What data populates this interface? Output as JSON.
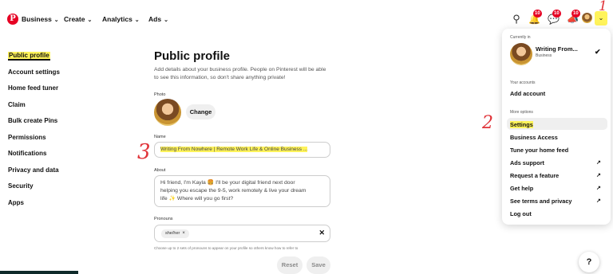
{
  "nav": {
    "logo_glyph": "P",
    "items": [
      "Business",
      "Create",
      "Analytics",
      "Ads"
    ],
    "chevron": "⌄",
    "badges": [
      "10",
      "10",
      "10"
    ]
  },
  "annotations": [
    "1",
    "2",
    "3"
  ],
  "sidebar": {
    "items": [
      {
        "label": "Public profile",
        "active": true
      },
      {
        "label": "Account settings"
      },
      {
        "label": "Home feed tuner"
      },
      {
        "label": "Claim"
      },
      {
        "label": "Bulk create Pins"
      },
      {
        "label": "Permissions"
      },
      {
        "label": "Notifications"
      },
      {
        "label": "Privacy and data"
      },
      {
        "label": "Security"
      },
      {
        "label": "Apps"
      }
    ]
  },
  "main": {
    "title": "Public profile",
    "description": "Add details about your business profile. People on Pinterest will be able to see this information, so don't share anything private!",
    "photo_label": "Photo",
    "change_label": "Change",
    "name_label": "Name",
    "name_value": "Writing From Nowhere | Remote Work Life & Online Business ...",
    "about_label": "About",
    "about_value": "Hi friend, I'm Kayla 🍔 I'll be your digital friend next door\nhelping you escape the 9-5, work remotely & live your dream\nlife ✨ Where will you go first?",
    "pronouns_label": "Pronouns",
    "pronoun_chip": "she/her",
    "pronouns_help": "Choose up to 2 sets of pronouns to appear on your profile so others know how to refer to",
    "reset_label": "Reset",
    "save_label": "Save"
  },
  "dropdown": {
    "currently_in": "Currently in",
    "account_name": "Writing From...",
    "account_type": "Business",
    "your_accounts": "Your accounts",
    "add_account": "Add account",
    "more_options": "More options",
    "items": [
      {
        "label": "Settings",
        "external": false
      },
      {
        "label": "Business Access",
        "external": false
      },
      {
        "label": "Tune your home feed",
        "external": false
      },
      {
        "label": "Ads support",
        "external": true
      },
      {
        "label": "Request a feature",
        "external": true
      },
      {
        "label": "Get help",
        "external": true
      },
      {
        "label": "See terms and privacy",
        "external": true
      },
      {
        "label": "Log out",
        "external": false
      }
    ],
    "external_glyph": "↗"
  },
  "help_button": "?"
}
